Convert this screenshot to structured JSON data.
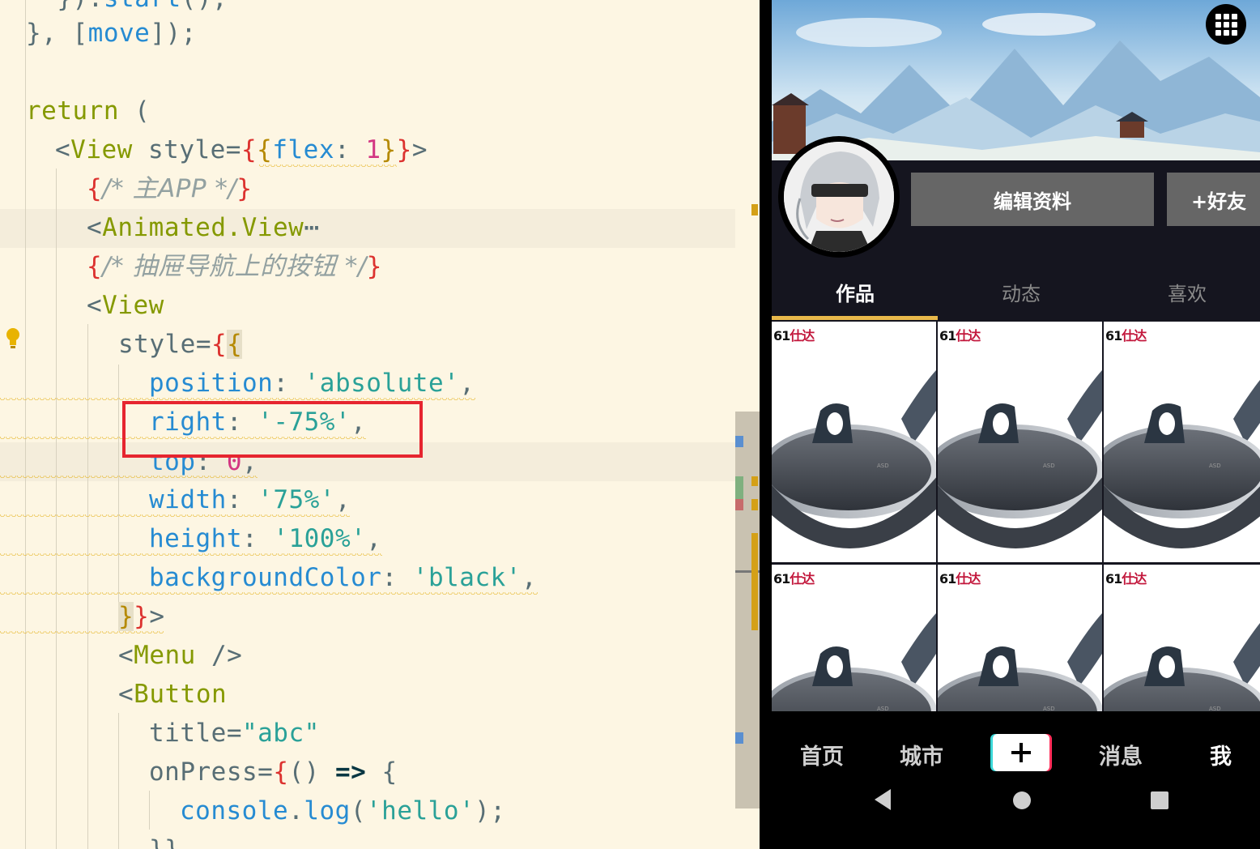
{
  "editor": {
    "lines": [
      "}).start();",
      "}, [move]);",
      "return (",
      "<View style={{flex: 1}}>",
      "{/* 主APP */}",
      "<Animated.View",
      "{/* 抽屉导航上的按钮 */}",
      "<View",
      "style={{",
      "position: 'absolute',",
      "right: '-75%',",
      "top: 0,",
      "width: '75%',",
      "height: '100%',",
      "backgroundColor: 'black',",
      "}}>",
      "<Menu />",
      "<Button",
      "title=\"abc\"",
      "onPress={() => {",
      "console.log('hello');",
      "}}"
    ],
    "fold_marker": "⋯"
  },
  "phone": {
    "edit_button": "编辑资料",
    "add_friend_button": "+好友",
    "tabs": [
      "作品",
      "动态",
      "喜欢"
    ],
    "active_tab": "作品",
    "tile_label_num": "61",
    "tile_label_brand": "仕达",
    "nav": [
      "首页",
      "城市",
      "消息",
      "我"
    ],
    "plus_glyph": "+",
    "colors": {
      "tab_underline": "#e8b84a",
      "button_bg": "#666666",
      "screen_bg": "#15151f"
    }
  }
}
